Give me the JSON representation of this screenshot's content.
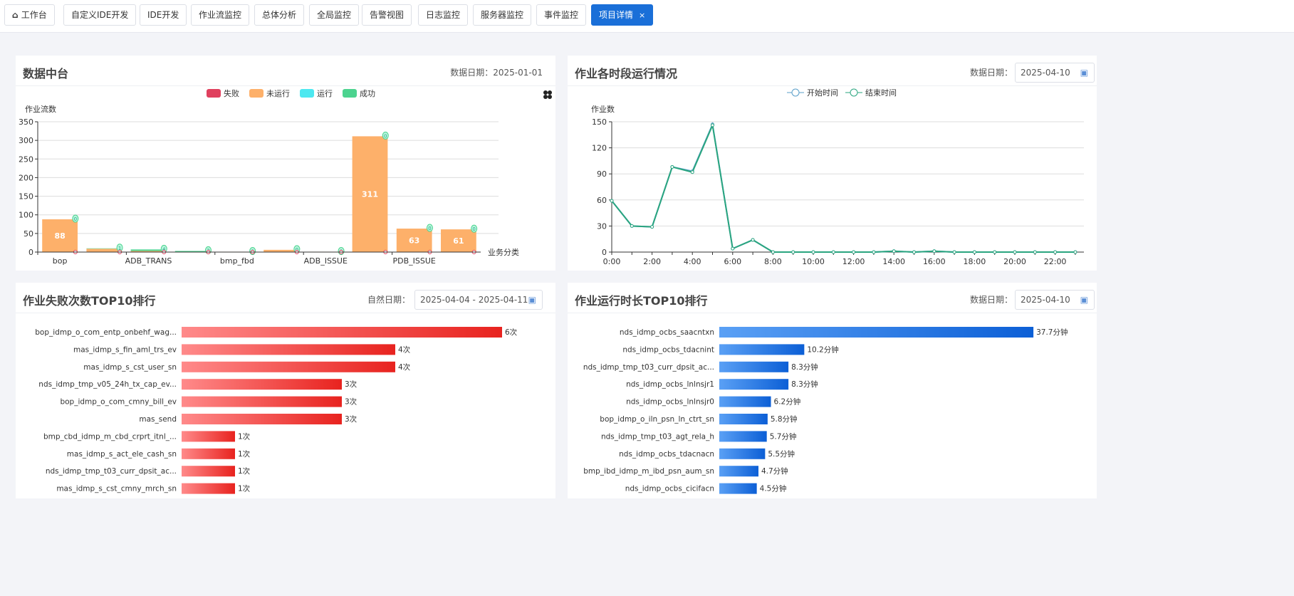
{
  "tabs": [
    {
      "label": "工作台",
      "icon": "home-icon"
    },
    {
      "label": "自定义IDE开发"
    },
    {
      "label": "IDE开发"
    },
    {
      "label": "作业流监控"
    },
    {
      "label": "总体分析"
    },
    {
      "label": "全局监控"
    },
    {
      "label": "告警视图"
    },
    {
      "label": "日志监控"
    },
    {
      "label": "服务器监控"
    },
    {
      "label": "事件监控"
    },
    {
      "label": "项目详情",
      "active": true,
      "close": "×"
    }
  ],
  "panel1": {
    "title": "数据中台",
    "date_label": "数据日期：",
    "date": "2025-01-01",
    "toolbox_icon": "grid-icon"
  },
  "panel2": {
    "title": "作业各时段运行情况",
    "date_label": "数据日期：",
    "date": "2025-04-10",
    "calendar_icon": "calendar-icon"
  },
  "panel3": {
    "title": "作业失败次数TOP10排行",
    "date_label": "自然日期：",
    "date": "2025-04-04 - 2025-04-11",
    "calendar_icon": "calendar-icon"
  },
  "panel4": {
    "title": "作业运行时长TOP10排行",
    "date_label": "数据日期：",
    "date": "2025-04-10",
    "calendar_icon": "calendar-icon"
  },
  "colors": {
    "accent": "#1a6fd8",
    "fail": "#e0405e",
    "not_run": "#fdb06a",
    "running": "#4de8f0",
    "success": "#4cd38f",
    "line_start": "#5a9fc9",
    "line_end": "#2aa57f",
    "fail_bar": "#e8231f",
    "dur_bar": "#1565d8"
  },
  "chart_data": [
    {
      "type": "bar",
      "stacked": true,
      "ylabel": "作业流数",
      "xlabel": "业务分类",
      "ylim": [
        0,
        350
      ],
      "yticks": [
        0,
        50,
        100,
        150,
        200,
        250,
        300,
        350
      ],
      "grid": true,
      "legend_position": "top",
      "categories": [
        "bop",
        "",
        "ADB_TRANS",
        "",
        "bmp_fbd",
        "",
        "ADB_ISSUE",
        "",
        "PDB_ISSUE",
        ""
      ],
      "series": [
        {
          "name": "失败",
          "values": [
            0,
            0,
            0,
            0,
            0,
            0,
            0,
            0,
            0,
            0
          ]
        },
        {
          "name": "未运行",
          "values": [
            88,
            9,
            3,
            0,
            1,
            6,
            1,
            311,
            63,
            61
          ]
        },
        {
          "name": "运行",
          "values": [
            0,
            0,
            0,
            0,
            0,
            0,
            0,
            0,
            0,
            0
          ]
        },
        {
          "name": "成功",
          "values": [
            0,
            1,
            4,
            3,
            0,
            0,
            0,
            0,
            0,
            0
          ]
        }
      ],
      "data_labels": {
        "未运行": [
          88,
          null,
          null,
          null,
          null,
          null,
          null,
          311,
          63,
          61
        ],
        "成功": [
          0,
          1,
          4,
          3,
          0,
          0,
          0,
          0,
          0,
          0
        ]
      }
    },
    {
      "type": "line",
      "ylabel": "作业数",
      "ylim": [
        0,
        150
      ],
      "yticks": [
        0,
        30,
        60,
        90,
        120,
        150
      ],
      "grid": true,
      "legend_position": "top",
      "x": [
        "0:00",
        "1:00",
        "2:00",
        "3:00",
        "4:00",
        "5:00",
        "6:00",
        "7:00",
        "8:00",
        "9:00",
        "10:00",
        "11:00",
        "12:00",
        "13:00",
        "14:00",
        "15:00",
        "16:00",
        "17:00",
        "18:00",
        "19:00",
        "20:00",
        "21:00",
        "22:00",
        "23:00"
      ],
      "xticks": [
        "0:00",
        "2:00",
        "4:00",
        "6:00",
        "8:00",
        "10:00",
        "12:00",
        "14:00",
        "16:00",
        "18:00",
        "20:00",
        "22:00"
      ],
      "series": [
        {
          "name": "开始时间",
          "values": [
            59,
            30,
            29,
            98,
            93,
            147,
            4,
            14,
            0,
            0,
            0,
            0,
            0,
            0,
            1,
            0,
            1,
            0,
            0,
            0,
            0,
            0,
            0,
            0
          ]
        },
        {
          "name": "结束时间",
          "values": [
            59,
            30,
            29,
            98,
            92,
            146,
            4,
            14,
            0,
            0,
            0,
            0,
            0,
            0,
            1,
            0,
            1,
            0,
            0,
            0,
            0,
            0,
            0,
            0
          ]
        }
      ]
    },
    {
      "type": "bar",
      "orientation": "horizontal",
      "unit": "次",
      "categories": [
        "bop_idmp_o_com_entp_onbehf_wag...",
        "mas_idmp_s_fin_aml_trs_ev",
        "mas_idmp_s_cst_user_sn",
        "nds_idmp_tmp_v05_24h_tx_cap_ev...",
        "bop_idmp_o_com_cmny_bill_ev",
        "mas_send",
        "bmp_cbd_idmp_m_cbd_crprt_itnl_...",
        "mas_idmp_s_act_ele_cash_sn",
        "nds_idmp_tmp_t03_curr_dpsit_ac...",
        "mas_idmp_s_cst_cmny_mrch_sn"
      ],
      "values": [
        6,
        4,
        4,
        3,
        3,
        3,
        1,
        1,
        1,
        1
      ],
      "labels": [
        "6次",
        "4次",
        "4次",
        "3次",
        "3次",
        "3次",
        "1次",
        "1次",
        "1次",
        "1次"
      ]
    },
    {
      "type": "bar",
      "orientation": "horizontal",
      "unit": "分钟",
      "categories": [
        "nds_idmp_ocbs_saacntxn",
        "nds_idmp_ocbs_tdacnint",
        "nds_idmp_tmp_t03_curr_dpsit_ac...",
        "nds_idmp_ocbs_lnlnsjr1",
        "nds_idmp_ocbs_lnlnsjr0",
        "bop_idmp_o_iln_psn_ln_ctrt_sn",
        "nds_idmp_tmp_t03_agt_rela_h",
        "nds_idmp_ocbs_tdacnacn",
        "bmp_ibd_idmp_m_ibd_psn_aum_sn",
        "nds_idmp_ocbs_cicifacn"
      ],
      "values": [
        37.7,
        10.2,
        8.3,
        8.3,
        6.2,
        5.8,
        5.7,
        5.5,
        4.7,
        4.5
      ],
      "labels": [
        "37.7分钟",
        "10.2分钟",
        "8.3分钟",
        "8.3分钟",
        "6.2分钟",
        "5.8分钟",
        "5.7分钟",
        "5.5分钟",
        "4.7分钟",
        "4.5分钟"
      ]
    }
  ]
}
